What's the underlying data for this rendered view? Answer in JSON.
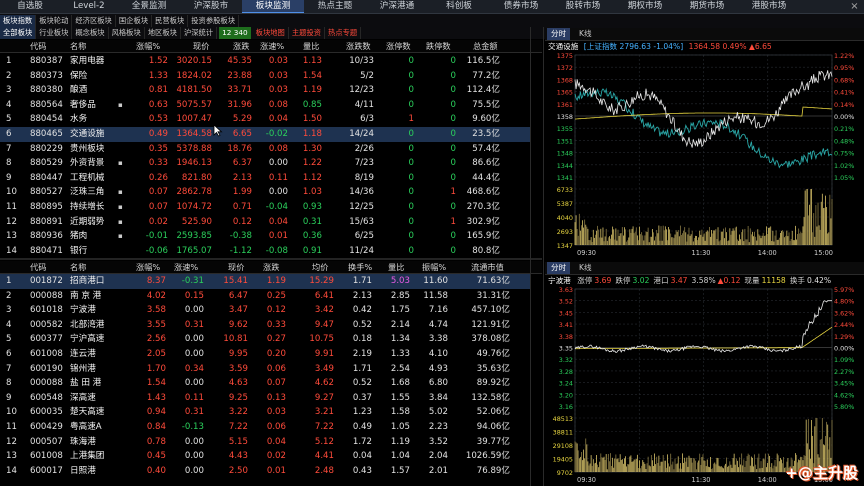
{
  "top_nav": [
    {
      "label": "自选股",
      "w": 60
    },
    {
      "label": "Level-2",
      "w": 58
    },
    {
      "label": "全景监测",
      "w": 62
    },
    {
      "label": "沪深股市",
      "w": 62
    },
    {
      "label": "板块监测",
      "w": 62,
      "active": true
    },
    {
      "label": "热点主题",
      "w": 62
    },
    {
      "label": "沪深港通",
      "w": 62
    },
    {
      "label": "科创板",
      "w": 62
    },
    {
      "label": "债券市场",
      "w": 62
    },
    {
      "label": "股转市场",
      "w": 62
    },
    {
      "label": "期权市场",
      "w": 62
    },
    {
      "label": "期货市场",
      "w": 62
    },
    {
      "label": "港股市场",
      "w": 62
    }
  ],
  "sub_nav": [
    {
      "label": "板块指数",
      "active": true
    },
    {
      "label": "板块轮动"
    },
    {
      "label": "经济区板块"
    },
    {
      "label": "国企板块"
    },
    {
      "label": "民营板块"
    },
    {
      "label": "投资参股板块"
    }
  ],
  "sub_nav2": [
    {
      "label": "全部板块",
      "active": true
    },
    {
      "label": "行业板块"
    },
    {
      "label": "概念板块"
    },
    {
      "label": "风格板块"
    },
    {
      "label": "地区板块"
    },
    {
      "label": "沪深统计"
    },
    {
      "label": "12  340",
      "box": true
    },
    {
      "label": "板块地图",
      "red": true
    },
    {
      "label": "主题投资",
      "red": true
    },
    {
      "label": "热点专题",
      "red": true
    }
  ],
  "upper_table": {
    "headers": [
      "代码",
      "名称",
      "涨幅%",
      "现价",
      "涨跌",
      "涨速%",
      "量比",
      "涨跌数",
      "涨停数",
      "跌停数",
      "总金额"
    ],
    "rows": [
      {
        "n": "1",
        "code": "880387",
        "name": "家用电器",
        "pct": "1.52",
        "price": "3020.15",
        "chg": "45.35",
        "speed": "0.03",
        "vr": "1.13",
        "ud": "10/33",
        "zt": "0",
        "dt": "0",
        "amt": "116.5亿",
        "d": "up",
        "sd": "up"
      },
      {
        "n": "2",
        "code": "880373",
        "name": "保险",
        "pct": "1.33",
        "price": "1824.02",
        "chg": "23.88",
        "speed": "0.03",
        "vr": "1.54",
        "ud": "5/2",
        "zt": "0",
        "dt": "0",
        "amt": "77.2亿",
        "d": "up",
        "sd": "up"
      },
      {
        "n": "3",
        "code": "880380",
        "name": "酿酒",
        "pct": "0.81",
        "price": "4181.50",
        "chg": "33.71",
        "speed": "0.03",
        "vr": "1.19",
        "ud": "12/23",
        "zt": "0",
        "dt": "0",
        "amt": "112.4亿",
        "d": "up",
        "sd": "up"
      },
      {
        "n": "4",
        "code": "880564",
        "name": "奢侈品",
        "pct": "0.63",
        "price": "5075.57",
        "chg": "31.96",
        "speed": "0.08",
        "vr": "0.85",
        "ud": "4/11",
        "zt": "0",
        "dt": "0",
        "amt": "75.5亿",
        "d": "up",
        "sd": "up",
        "mk": true
      },
      {
        "n": "5",
        "code": "880454",
        "name": "水务",
        "pct": "0.53",
        "price": "1007.47",
        "chg": "5.29",
        "speed": "0.04",
        "vr": "1.50",
        "ud": "6/3",
        "zt": "1",
        "dt": "0",
        "amt": "9.60亿",
        "d": "up",
        "sd": "up"
      },
      {
        "n": "6",
        "code": "880465",
        "name": "交通设施",
        "pct": "0.49",
        "price": "1364.58",
        "chg": "6.65",
        "speed": "-0.02",
        "vr": "1.18",
        "ud": "14/24",
        "zt": "0",
        "dt": "0",
        "amt": "23.5亿",
        "d": "up",
        "sd": "dn",
        "sel": true
      },
      {
        "n": "7",
        "code": "880229",
        "name": "贵州板块",
        "pct": "0.35",
        "price": "5378.88",
        "chg": "18.76",
        "speed": "0.08",
        "vr": "1.30",
        "ud": "2/26",
        "zt": "0",
        "dt": "0",
        "amt": "57.4亿",
        "d": "up",
        "sd": "up"
      },
      {
        "n": "8",
        "code": "880529",
        "name": "外资背景",
        "pct": "0.33",
        "price": "1946.13",
        "chg": "6.37",
        "speed": "0.00",
        "vr": "1.22",
        "ud": "7/23",
        "zt": "0",
        "dt": "0",
        "amt": "86.6亿",
        "d": "up",
        "sd": "nt",
        "mk": true
      },
      {
        "n": "9",
        "code": "880447",
        "name": "工程机械",
        "pct": "0.26",
        "price": "821.80",
        "chg": "2.13",
        "speed": "0.11",
        "vr": "1.12",
        "ud": "8/19",
        "zt": "0",
        "dt": "0",
        "amt": "44.4亿",
        "d": "up",
        "sd": "up"
      },
      {
        "n": "10",
        "code": "880527",
        "name": "泛珠三角",
        "pct": "0.07",
        "price": "2862.78",
        "chg": "1.99",
        "speed": "0.00",
        "vr": "1.03",
        "ud": "14/36",
        "zt": "0",
        "dt": "1",
        "amt": "468.6亿",
        "d": "up",
        "sd": "nt",
        "mk": true
      },
      {
        "n": "11",
        "code": "880895",
        "name": "持续增长",
        "pct": "0.07",
        "price": "1074.72",
        "chg": "0.71",
        "speed": "-0.04",
        "vr": "0.93",
        "ud": "12/25",
        "zt": "0",
        "dt": "0",
        "amt": "270.3亿",
        "d": "up",
        "sd": "dn",
        "mk": true
      },
      {
        "n": "12",
        "code": "880891",
        "name": "近期弱势",
        "pct": "0.02",
        "price": "525.90",
        "chg": "0.12",
        "speed": "0.04",
        "vr": "0.31",
        "ud": "15/63",
        "zt": "0",
        "dt": "1",
        "amt": "302.9亿",
        "d": "up",
        "sd": "up",
        "mk": true
      },
      {
        "n": "13",
        "code": "880936",
        "name": "猪肉",
        "pct": "-0.01",
        "price": "2593.85",
        "chg": "-0.38",
        "speed": "0.01",
        "vr": "0.36",
        "ud": "6/25",
        "zt": "0",
        "dt": "0",
        "amt": "165.9亿",
        "d": "dn",
        "sd": "up",
        "mk": true
      },
      {
        "n": "14",
        "code": "880471",
        "name": "银行",
        "pct": "-0.06",
        "price": "1765.07",
        "chg": "-1.12",
        "speed": "-0.08",
        "vr": "0.91",
        "ud": "11/24",
        "zt": "0",
        "dt": "0",
        "amt": "80.8亿",
        "d": "dn",
        "sd": "dn"
      }
    ]
  },
  "lower_table": {
    "headers": [
      "代码",
      "名称",
      "涨幅%",
      "涨速%",
      "现价",
      "涨跌",
      "均价",
      "换手%",
      "量比",
      "振幅%",
      "流通市值"
    ],
    "rows": [
      {
        "n": "1",
        "code": "001872",
        "name": "招商港口",
        "pct": "8.37",
        "speed": "-0.31",
        "price": "15.41",
        "chg": "1.19",
        "avg": "15.29",
        "turn": "1.71",
        "vr": "5.03",
        "amp": "11.60",
        "mv": "71.63亿",
        "sel": true,
        "sd": "dn",
        "vrc": "mag"
      },
      {
        "n": "2",
        "code": "000088",
        "name": "南 京 港",
        "pct": "4.02",
        "speed": "0.15",
        "price": "6.47",
        "chg": "0.25",
        "avg": "6.41",
        "turn": "2.13",
        "vr": "2.85",
        "amp": "11.58",
        "mv": "31.31亿",
        "sd": "up",
        "vrc": "nt"
      },
      {
        "n": "3",
        "code": "601018",
        "name": "宁波港",
        "pct": "3.58",
        "speed": "0.00",
        "price": "3.47",
        "chg": "0.12",
        "avg": "3.42",
        "turn": "0.42",
        "vr": "1.75",
        "amp": "7.16",
        "mv": "457.10亿",
        "sd": "nt",
        "vrc": "nt"
      },
      {
        "n": "4",
        "code": "000582",
        "name": "北部湾港",
        "pct": "3.55",
        "speed": "0.31",
        "price": "9.62",
        "chg": "0.33",
        "avg": "9.47",
        "turn": "0.52",
        "vr": "2.14",
        "amp": "4.74",
        "mv": "121.91亿",
        "sd": "up",
        "vrc": "nt"
      },
      {
        "n": "5",
        "code": "600377",
        "name": "宁沪高速",
        "pct": "2.56",
        "speed": "0.00",
        "price": "10.81",
        "chg": "0.27",
        "avg": "10.75",
        "turn": "0.18",
        "vr": "1.34",
        "amp": "3.38",
        "mv": "378.08亿",
        "sd": "nt",
        "vrc": "nt"
      },
      {
        "n": "6",
        "code": "601008",
        "name": "连云港",
        "pct": "2.05",
        "speed": "0.00",
        "price": "9.95",
        "chg": "0.20",
        "avg": "9.91",
        "turn": "2.19",
        "vr": "1.33",
        "amp": "4.10",
        "mv": "49.76亿",
        "sd": "nt",
        "vrc": "nt"
      },
      {
        "n": "7",
        "code": "600190",
        "name": "锦州港",
        "pct": "1.70",
        "speed": "0.34",
        "price": "3.59",
        "chg": "0.06",
        "avg": "3.49",
        "turn": "1.71",
        "vr": "2.54",
        "amp": "4.93",
        "mv": "35.63亿",
        "sd": "up",
        "vrc": "nt"
      },
      {
        "n": "8",
        "code": "000088",
        "name": "盐 田 港",
        "pct": "1.54",
        "speed": "0.00",
        "price": "4.63",
        "chg": "0.07",
        "avg": "4.62",
        "turn": "0.52",
        "vr": "1.68",
        "amp": "6.80",
        "mv": "89.92亿",
        "sd": "nt",
        "vrc": "nt"
      },
      {
        "n": "9",
        "code": "600548",
        "name": "深高速",
        "pct": "1.43",
        "speed": "0.11",
        "price": "9.25",
        "chg": "0.13",
        "avg": "9.27",
        "turn": "0.37",
        "vr": "1.55",
        "amp": "3.84",
        "mv": "132.58亿",
        "sd": "up",
        "vrc": "nt"
      },
      {
        "n": "10",
        "code": "600035",
        "name": "楚天高速",
        "pct": "0.94",
        "speed": "0.31",
        "price": "3.22",
        "chg": "0.03",
        "avg": "3.21",
        "turn": "1.23",
        "vr": "1.58",
        "amp": "5.02",
        "mv": "52.06亿",
        "sd": "up",
        "vrc": "nt"
      },
      {
        "n": "11",
        "code": "600429",
        "name": "粤高速A",
        "pct": "0.84",
        "speed": "-0.13",
        "price": "7.22",
        "chg": "0.06",
        "avg": "7.22",
        "turn": "0.49",
        "vr": "1.05",
        "amp": "2.23",
        "mv": "94.06亿",
        "sd": "dn",
        "vrc": "nt"
      },
      {
        "n": "12",
        "code": "000507",
        "name": "珠海港",
        "pct": "0.78",
        "speed": "0.00",
        "price": "5.15",
        "chg": "0.04",
        "avg": "5.12",
        "turn": "1.72",
        "vr": "1.19",
        "amp": "3.52",
        "mv": "39.77亿",
        "sd": "nt",
        "vrc": "nt"
      },
      {
        "n": "13",
        "code": "601008",
        "name": "上港集团",
        "pct": "0.45",
        "speed": "0.00",
        "price": "4.43",
        "chg": "0.02",
        "avg": "4.41",
        "turn": "0.04",
        "vr": "1.04",
        "amp": "2.04",
        "mv": "1026.59亿",
        "sd": "nt",
        "vrc": "nt"
      },
      {
        "n": "14",
        "code": "600017",
        "name": "日照港",
        "pct": "0.40",
        "speed": "0.00",
        "price": "2.50",
        "chg": "0.01",
        "avg": "2.48",
        "turn": "0.43",
        "vr": "1.57",
        "amp": "2.01",
        "mv": "76.89亿",
        "sd": "nt",
        "vrc": "nt"
      }
    ]
  },
  "upper_chart": {
    "tabs": [
      "分时",
      "K线"
    ],
    "title": "交通设施",
    "index_info": "[上证指数 2796.63 -1.04%]",
    "price_info": "1364.58 0.49% ▲6.65",
    "left_axis": [
      "1375",
      "1372",
      "1368",
      "1365",
      "1361",
      "1358",
      "1355",
      "1351",
      "1348",
      "1344",
      "1341"
    ],
    "right_axis": [
      "1.22%",
      "0.95%",
      "0.68%",
      "0.41%",
      "0.14%",
      "0.00%",
      "0.21%",
      "0.48%",
      "0.75%",
      "1.02%",
      "1.05%"
    ],
    "vol_axis": [
      "6733",
      "5387",
      "4040",
      "2693",
      "1347"
    ],
    "time_axis": [
      "09:30",
      "11:30",
      "14:00",
      "15:00"
    ]
  },
  "lower_chart": {
    "tabs": [
      "分时",
      "K线"
    ],
    "title": "宁波港",
    "info_items": [
      {
        "label": "涨停",
        "value": "3.69",
        "color": "#ff4b3b"
      },
      {
        "label": "跌停",
        "value": "3.02",
        "color": "#2bd05c"
      },
      {
        "label": "港口",
        "value": "3.47",
        "color": "#ff4b3b"
      },
      {
        "label": "3.58%",
        "value": "▲0.12",
        "color": "#ff4b3b"
      },
      {
        "label": "现量",
        "value": "11158",
        "color": "#e8d641"
      },
      {
        "label": "换手",
        "value": "0.42%",
        "color": "#e2e2e2"
      }
    ],
    "left_axis": [
      "3.63",
      "3.52",
      "3.45",
      "3.41",
      "3.38",
      "3.35",
      "3.32",
      "3.28",
      "3.24",
      "3.20",
      "3.16"
    ],
    "right_axis": [
      "5.97%",
      "4.80%",
      "3.62%",
      "2.44%",
      "1.29%",
      "0.00%",
      "1.09%",
      "2.27%",
      "3.45%",
      "4.62%",
      "5.80%"
    ],
    "vol_axis": [
      "48513",
      "38811",
      "29108",
      "19405",
      "9702"
    ],
    "time_axis": [
      "09:30",
      "11:30",
      "14:00",
      "15:00"
    ]
  },
  "watermark": "+@主升股",
  "colors": {
    "up": "#ff4b3b",
    "down": "#2bd05c",
    "accent": "#2a3f66"
  }
}
